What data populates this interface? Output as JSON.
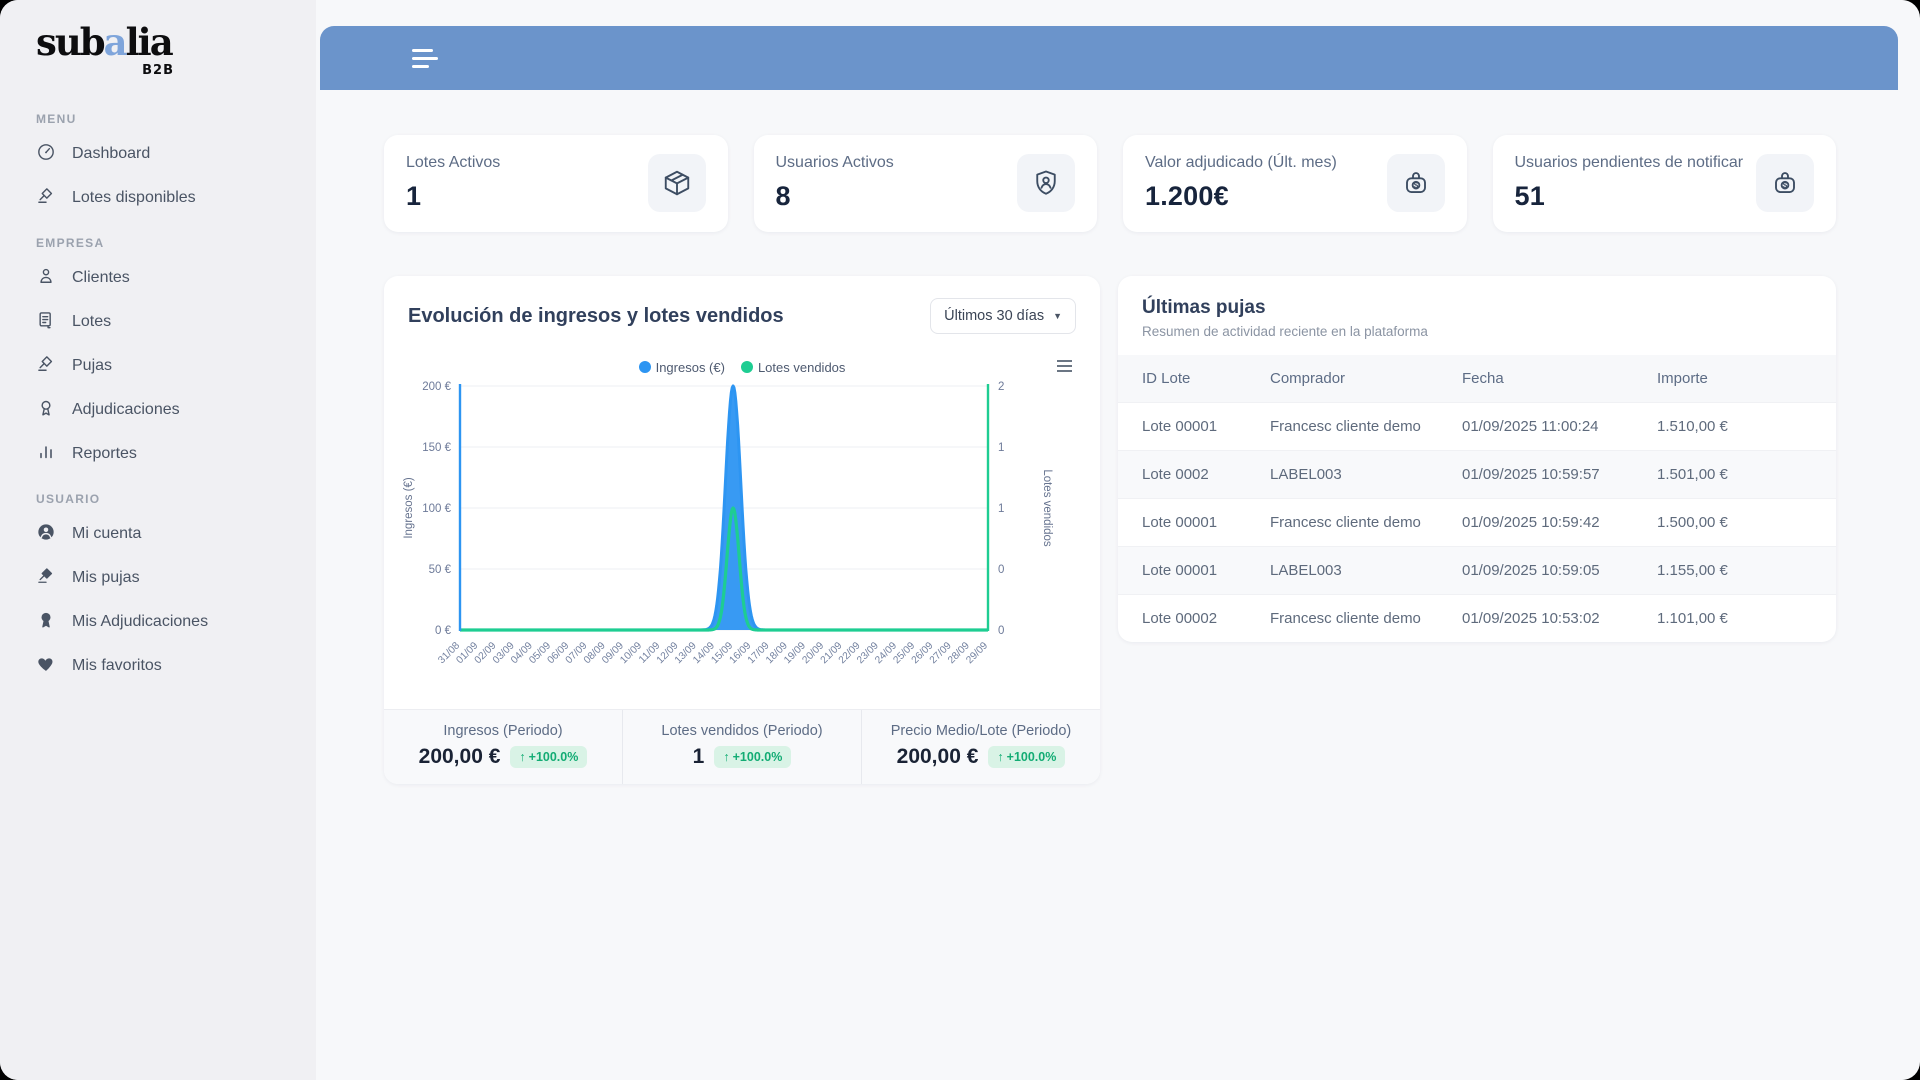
{
  "sidebar": {
    "logo": {
      "part1": "sub",
      "accent": "a",
      "part2": "lia",
      "badge": "B2B"
    },
    "sections": [
      {
        "label": "MENU",
        "items": [
          {
            "label": "Dashboard",
            "icon": "dashboard-icon"
          },
          {
            "label": "Lotes disponibles",
            "icon": "gavel-icon"
          }
        ]
      },
      {
        "label": "EMPRESA",
        "items": [
          {
            "label": "Clientes",
            "icon": "person-icon"
          },
          {
            "label": "Lotes",
            "icon": "document-icon"
          },
          {
            "label": "Pujas",
            "icon": "gavel-icon"
          },
          {
            "label": "Adjudicaciones",
            "icon": "award-icon"
          },
          {
            "label": "Reportes",
            "icon": "bar-chart-icon"
          }
        ]
      },
      {
        "label": "USUARIO",
        "items": [
          {
            "label": "Mi cuenta",
            "icon": "user-circle-icon"
          },
          {
            "label": "Mis pujas",
            "icon": "gavel-filled-icon"
          },
          {
            "label": "Mis Adjudicaciones",
            "icon": "award-filled-icon"
          },
          {
            "label": "Mis favoritos",
            "icon": "heart-icon"
          }
        ]
      }
    ]
  },
  "stats": [
    {
      "label": "Lotes Activos",
      "value": "1",
      "icon": "package-icon"
    },
    {
      "label": "Usuarios Activos",
      "value": "8",
      "icon": "shield-user-icon"
    },
    {
      "label": "Valor adjudicado (Últ. mes)",
      "value": "1.200€",
      "icon": "money-bag-icon"
    },
    {
      "label": "Usuarios pendientes de notificar",
      "value": "51",
      "icon": "money-bag-icon"
    }
  ],
  "chart_card": {
    "title": "Evolución de ingresos y lotes vendidos",
    "range_selector": "Últimos 30 días",
    "footer_stats": [
      {
        "label": "Ingresos (Periodo)",
        "value": "200,00 €",
        "delta": "+100.0%"
      },
      {
        "label": "Lotes vendidos (Periodo)",
        "value": "1",
        "delta": "+100.0%"
      },
      {
        "label": "Precio Medio/Lote (Periodo)",
        "value": "200,00 €",
        "delta": "+100.0%"
      }
    ]
  },
  "chart_data": {
    "type": "area",
    "title": "Evolución de ingresos y lotes vendidos",
    "categories": [
      "31/08",
      "01/09",
      "02/09",
      "03/09",
      "04/09",
      "05/09",
      "06/09",
      "07/09",
      "08/09",
      "09/09",
      "10/09",
      "11/09",
      "12/09",
      "13/09",
      "14/09",
      "15/09",
      "16/09",
      "17/09",
      "18/09",
      "19/09",
      "20/09",
      "21/09",
      "22/09",
      "23/09",
      "24/09",
      "25/09",
      "26/09",
      "27/09",
      "28/09",
      "29/09"
    ],
    "series": [
      {
        "name": "Ingresos (€)",
        "axis": "left",
        "color": "#2d95f2",
        "values": [
          0,
          0,
          0,
          0,
          0,
          0,
          0,
          0,
          0,
          0,
          0,
          0,
          0,
          0,
          0,
          200,
          0,
          0,
          0,
          0,
          0,
          0,
          0,
          0,
          0,
          0,
          0,
          0,
          0,
          0
        ]
      },
      {
        "name": "Lotes vendidos",
        "axis": "right",
        "color": "#1ecd92",
        "values": [
          0,
          0,
          0,
          0,
          0,
          0,
          0,
          0,
          0,
          0,
          0,
          0,
          0,
          0,
          0,
          1,
          0,
          0,
          0,
          0,
          0,
          0,
          0,
          0,
          0,
          0,
          0,
          0,
          0,
          0
        ]
      }
    ],
    "left_axis": {
      "label": "Ingresos (€)",
      "ticks": [
        "200 €",
        "150 €",
        "100 €",
        "50 €",
        "0 €"
      ],
      "max": 200
    },
    "right_axis": {
      "label": "Lotes vendidos",
      "ticks": [
        "2",
        "1",
        "1",
        "0",
        "0"
      ],
      "max": 2
    },
    "legend_position": "top",
    "grid": true
  },
  "bids_card": {
    "title": "Últimas pujas",
    "subtitle": "Resumen de actividad reciente en la plataforma",
    "columns": [
      "ID Lote",
      "Comprador",
      "Fecha",
      "Importe"
    ],
    "rows": [
      [
        "Lote 00001",
        "Francesc cliente demo",
        "01/09/2025 11:00:24",
        "1.510,00 €"
      ],
      [
        "Lote 0002",
        "LABEL003",
        "01/09/2025 10:59:57",
        "1.501,00 €"
      ],
      [
        "Lote 00001",
        "Francesc cliente demo",
        "01/09/2025 10:59:42",
        "1.500,00 €"
      ],
      [
        "Lote 00001",
        "LABEL003",
        "01/09/2025 10:59:05",
        "1.155,00 €"
      ],
      [
        "Lote 00002",
        "Francesc cliente demo",
        "01/09/2025 10:53:02",
        "1.101,00 €"
      ]
    ]
  },
  "colors": {
    "topbar_blue": "#6b94cb",
    "chart_blue": "#2d95f2",
    "chart_green": "#1ecd92",
    "badge_green_bg": "#d9f3e6",
    "badge_green_text": "#13ac74",
    "logo_accent": "#7fa5db"
  }
}
